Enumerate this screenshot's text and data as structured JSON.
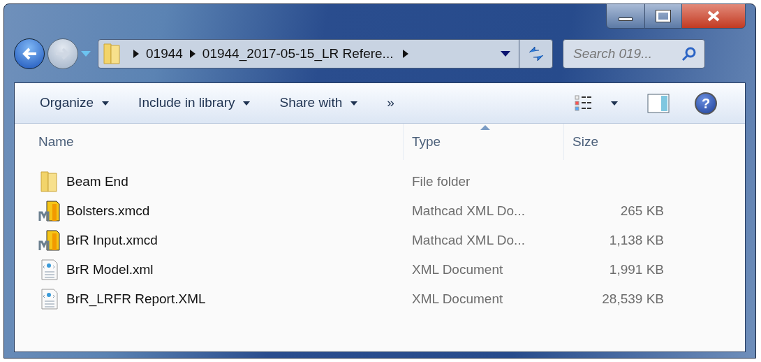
{
  "address_bar": {
    "crumbs": [
      "01944",
      "01944_2017-05-15_LR Refere..."
    ]
  },
  "search": {
    "placeholder": "Search 019..."
  },
  "help_button": {
    "label": "?"
  },
  "toolbar": {
    "buttons": [
      {
        "label": "Organize",
        "dropdown": true
      },
      {
        "label": "Include in library",
        "dropdown": true
      },
      {
        "label": "Share with",
        "dropdown": true
      },
      {
        "label": "»",
        "dropdown": false
      }
    ]
  },
  "table": {
    "columns": [
      {
        "label": "Name",
        "sorted": false
      },
      {
        "label": "Type",
        "sorted": true
      },
      {
        "label": "Size",
        "sorted": false
      }
    ],
    "rows": [
      {
        "kind": "folder",
        "name": "Beam End",
        "type": "File folder"
      },
      {
        "kind": "mathcad",
        "name": "Bolsters.xmcd",
        "type": "Mathcad XML Do...",
        "size": "265 KB"
      },
      {
        "kind": "mathcad",
        "name": "BrR Input.xmcd",
        "type": "Mathcad XML Do...",
        "size": "1,138 KB"
      },
      {
        "kind": "xml",
        "name": "BrR Model.xml",
        "type": "XML Document",
        "size": "1,991 KB"
      },
      {
        "kind": "xml",
        "name": "BrR_LRFR Report.XML",
        "type": "XML Document",
        "size": "28,539 KB"
      }
    ]
  }
}
